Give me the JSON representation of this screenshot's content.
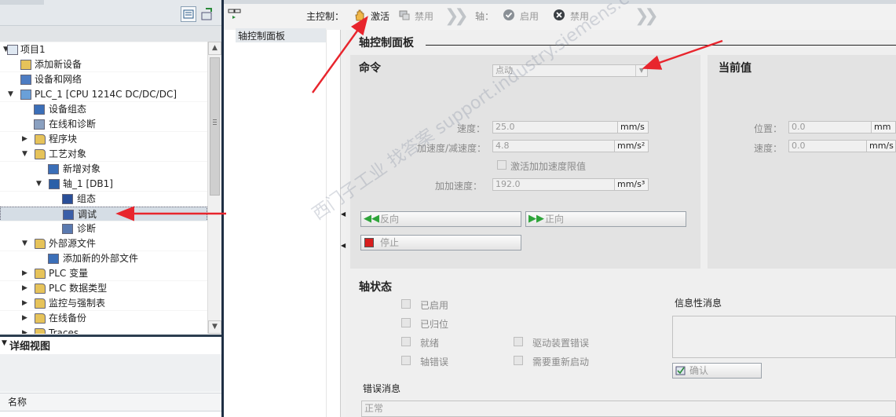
{
  "project_tree": {
    "items": [
      {
        "label": "项目1",
        "expander": "▼",
        "icon": "project-icon"
      },
      {
        "label": "添加新设备",
        "expander": "",
        "icon": "add-device-icon"
      },
      {
        "label": "设备和网络",
        "expander": "",
        "icon": "network-icon"
      },
      {
        "label": "PLC_1 [CPU 1214C DC/DC/DC]",
        "expander": "▼",
        "icon": "plc-icon"
      },
      {
        "label": "设备组态",
        "expander": "",
        "icon": "device-config-icon"
      },
      {
        "label": "在线和诊断",
        "expander": "",
        "icon": "online-diagnostics-icon"
      },
      {
        "label": "程序块",
        "expander": "▶",
        "icon": "folder-icon"
      },
      {
        "label": "工艺对象",
        "expander": "▼",
        "icon": "folder-icon"
      },
      {
        "label": "新增对象",
        "expander": "",
        "icon": "add-object-icon"
      },
      {
        "label": "轴_1 [DB1]",
        "expander": "▼",
        "icon": "axis-icon"
      },
      {
        "label": "组态",
        "expander": "",
        "icon": "config-icon"
      },
      {
        "label": "调试",
        "expander": "",
        "icon": "commissioning-icon"
      },
      {
        "label": "诊断",
        "expander": "",
        "icon": "diagnostics-icon"
      },
      {
        "label": "外部源文件",
        "expander": "▼",
        "icon": "folder-icon"
      },
      {
        "label": "添加新的外部文件",
        "expander": "",
        "icon": "add-file-icon"
      },
      {
        "label": "PLC 变量",
        "expander": "▶",
        "icon": "folder-icon"
      },
      {
        "label": "PLC 数据类型",
        "expander": "▶",
        "icon": "folder-icon"
      },
      {
        "label": "监控与强制表",
        "expander": "▶",
        "icon": "folder-icon"
      },
      {
        "label": "在线备份",
        "expander": "▶",
        "icon": "folder-icon"
      },
      {
        "label": "Traces",
        "expander": "▶",
        "icon": "folder-icon"
      }
    ]
  },
  "detail_view": {
    "title": "详细视图",
    "column_name": "名称",
    "expander": "▼"
  },
  "toolbar": {
    "master_control_label": "主控制：",
    "activate_label": "激活",
    "disable_label": "禁用",
    "axis_label": "轴：",
    "enable_label": "启用",
    "axis_disable_label": "禁用"
  },
  "function_list": {
    "item": "轴控制面板"
  },
  "panel": {
    "title": "轴控制面板",
    "command_section": {
      "title": "命令",
      "mode_value": "点动",
      "speed_label": "速度：",
      "speed_value": "25.0",
      "speed_unit": "mm/s",
      "accel_label": "加速度/减速度：",
      "accel_value": "4.8",
      "accel_unit": "mm/s²",
      "jerk_checkbox_label": "激活加加速度限值",
      "jerk_label": "加加速度：",
      "jerk_value": "192.0",
      "jerk_unit": "mm/s³",
      "backward_label": "反向",
      "forward_label": "正向",
      "stop_label": "停止"
    },
    "current_values": {
      "title": "当前值",
      "position_label": "位置：",
      "position_value": "0.0",
      "position_unit": "mm",
      "speed_label": "速度：",
      "speed_value": "0.0",
      "speed_unit": "mm/s"
    },
    "axis_status": {
      "title": "轴状态",
      "enabled": "已启用",
      "homed": "已归位",
      "ready": "就绪",
      "axis_error": "轴错误",
      "drive_error": "驱动装置错误",
      "restart_required": "需要重新启动",
      "info_message_label": "信息性消息",
      "confirm_label": "确认",
      "error_message_label": "错误消息",
      "error_message_value": "正常"
    }
  },
  "watermark": "西门子工业 找答案 support.industry.siemens.com/cs",
  "colors": {
    "arrow_red": "#e8252d",
    "selection": "#d5dde5",
    "dark_divider": "#1f2f44"
  }
}
